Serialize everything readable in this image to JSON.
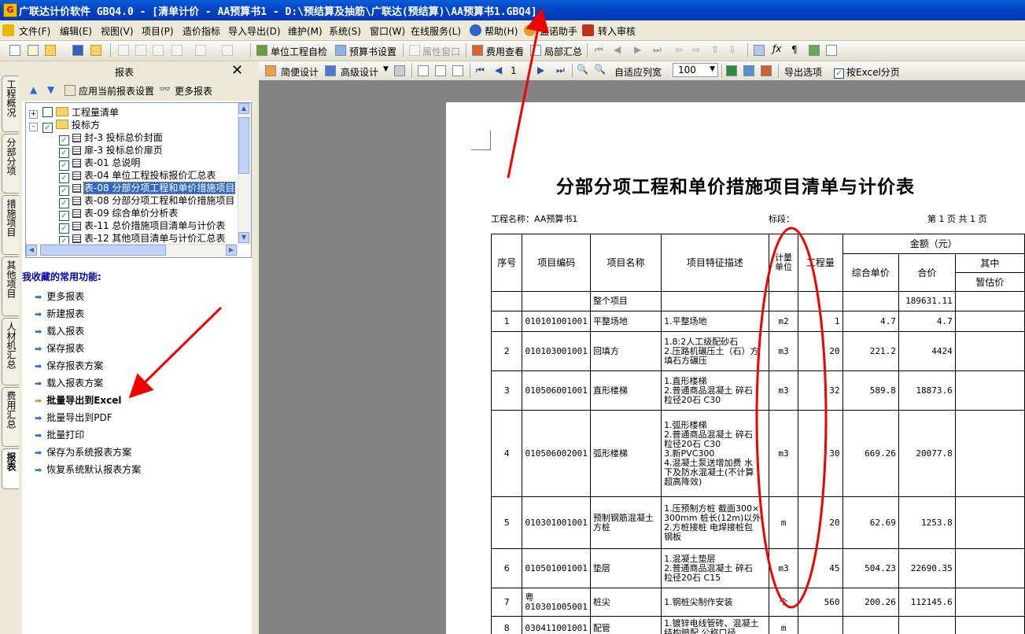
{
  "window": {
    "title": "广联达计价软件 GBQ4.0 - [清单计价 - AA预算书1 - D:\\预结算及抽筋\\广联达(预结算)\\AA预算书1.GBQ4]"
  },
  "menu": [
    "文件(F)",
    "编辑(E)",
    "视图(V)",
    "项目(P)",
    "造价指标",
    "导入导出(D)",
    "维护(M)",
    "系统(S)",
    "窗口(W)",
    "在线服务(L)",
    "帮助(H)",
    "蓝诺助手",
    "转入审核"
  ],
  "toolbar1": {
    "unit_check": "单位工程自检",
    "budget_settings": "预算书设置",
    "property_window": "属性窗口",
    "fee_view": "费用查看",
    "partial_summary": "局部汇总"
  },
  "left_tabs": [
    "工程概况",
    "分部分项",
    "措施项目",
    "其他项目",
    "人材机汇总",
    "费用汇总",
    "报表"
  ],
  "report_panel": {
    "title": "报表",
    "apply_settings": "应用当前报表设置",
    "more_reports": "更多报表",
    "tree": [
      {
        "label": "工程量清单",
        "level": 0,
        "type": "folder",
        "expand": "+"
      },
      {
        "label": "投标方",
        "level": 0,
        "type": "folder",
        "expand": "-"
      },
      {
        "label": "封-3 投标总价封面",
        "level": 1,
        "type": "report"
      },
      {
        "label": "扉-3 投标总价扉页",
        "level": 1,
        "type": "report"
      },
      {
        "label": "表-01 总说明",
        "level": 1,
        "type": "report"
      },
      {
        "label": "表-04 单位工程投标报价汇总表",
        "level": 1,
        "type": "report"
      },
      {
        "label": "表-08 分部分项工程和单价措施项目",
        "level": 1,
        "type": "report",
        "selected": true
      },
      {
        "label": "表-08 分部分项工程和单价措施项目",
        "level": 1,
        "type": "report"
      },
      {
        "label": "表-09 综合单价分析表",
        "level": 1,
        "type": "report"
      },
      {
        "label": "表-11 总价措施项目清单与计价表",
        "level": 1,
        "type": "report"
      },
      {
        "label": "表-12 其他项目清单与计价汇总表",
        "level": 1,
        "type": "report"
      }
    ],
    "favorites_title": "我收藏的常用功能:",
    "favorites": [
      "更多报表",
      "新建报表",
      "载入报表",
      "保存报表",
      "保存报表方案",
      "载入报表方案",
      "批量导出到Excel",
      "批量导出到PDF",
      "批量打印",
      "保存为系统报表方案",
      "恢复系统默认报表方案"
    ]
  },
  "preview_toolbar": {
    "simple_design": "简便设计",
    "advanced_design": "高级设计",
    "page": "1",
    "fit_width": "自适应列宽",
    "zoom": "100",
    "export_options": "导出选项",
    "excel_paging": "按Excel分页"
  },
  "report": {
    "title": "分部分项工程和单价措施项目清单与计价表",
    "project_name": "工程名称：AA预算书1",
    "section": "标段：",
    "page_info": "第  1  页  共  1  页",
    "headers": {
      "seq": "序号",
      "code": "项目编码",
      "name": "项目名称",
      "desc": "项目特征描述",
      "unit": "计量单位",
      "qty": "工程量",
      "amount": "金额（元）",
      "unit_price": "综合单价",
      "total": "合价",
      "of_which": "其中",
      "provisional": "暂估价"
    },
    "rows": [
      {
        "seq": "",
        "code": "",
        "name": "整个项目",
        "desc": "",
        "unit": "",
        "qty": "",
        "price": "",
        "total": "189631.11"
      },
      {
        "seq": "1",
        "code": "010101001001",
        "name": "平整场地",
        "desc": "1.平整场地",
        "unit": "m2",
        "qty": "1",
        "price": "4.7",
        "total": "4.7"
      },
      {
        "seq": "2",
        "code": "010103001001",
        "name": "回填方",
        "desc": "1.8:2人工级配砂石\n2.压路机碾压土（石）方\n  填石方碾压",
        "unit": "m3",
        "qty": "20",
        "price": "221.2",
        "total": "4424"
      },
      {
        "seq": "3",
        "code": "010506001001",
        "name": "直形楼梯",
        "desc": "1.直形楼梯\n2.普通商品混凝土 碎石\n粒径20石 C30",
        "unit": "m3",
        "qty": "32",
        "price": "589.8",
        "total": "18873.6"
      },
      {
        "seq": "4",
        "code": "010506002001",
        "name": "弧形楼梯",
        "desc": "1.弧形楼梯\n2.普通商品混凝土 碎石\n粒径20石 C30\n3.新PVC300\n4.混凝土泵送增加费 水\n下及防水混凝土(不计算\n超高降效)",
        "unit": "m3",
        "qty": "30",
        "price": "669.26",
        "total": "20077.8"
      },
      {
        "seq": "5",
        "code": "010301001001",
        "name": "预制钢筋混凝土方桩",
        "desc": "1.压预制方桩 截面300×\n300mm 桩长(12m)以外\n2.方桩接桩 电焊接桩包\n钢板",
        "unit": "m",
        "qty": "20",
        "price": "62.69",
        "total": "1253.8"
      },
      {
        "seq": "6",
        "code": "010501001001",
        "name": "垫层",
        "desc": "1.混凝土垫层\n2.普通商品混凝土 碎石\n粒径20石 C15",
        "unit": "m3",
        "qty": "45",
        "price": "504.23",
        "total": "22690.35"
      },
      {
        "seq": "7",
        "code": "粤\n010301005001",
        "name": "桩尖",
        "desc": "1.钢桩尖制作安装",
        "unit": "个",
        "qty": "560",
        "price": "200.26",
        "total": "112145.6"
      },
      {
        "seq": "8",
        "code": "030411001001",
        "name": "配管",
        "desc": "1.镀锌电线管砖、混凝土\n结构暗配 公称口径",
        "unit": "m",
        "qty": "",
        "price": "",
        "total": ""
      }
    ]
  }
}
